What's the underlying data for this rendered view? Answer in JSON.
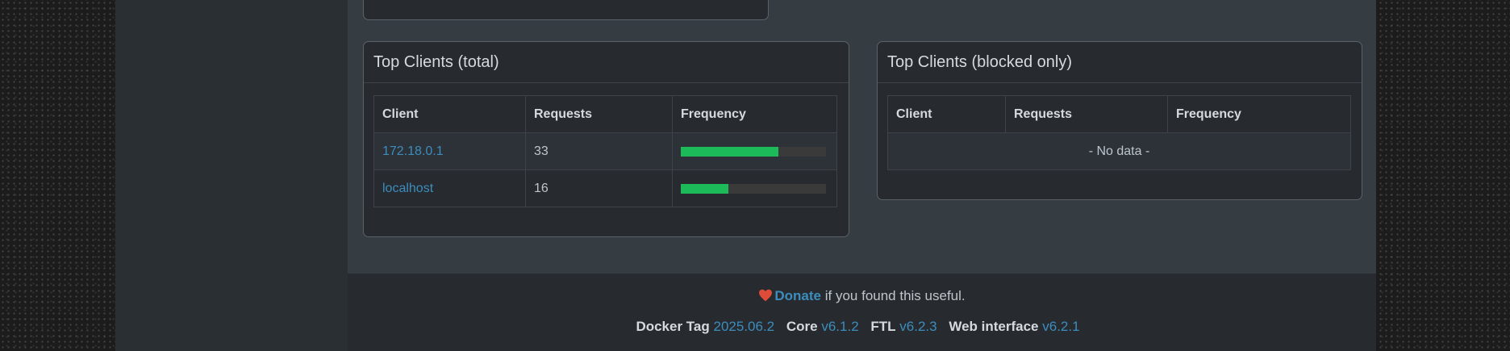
{
  "top_clients_total": {
    "title": "Top Clients (total)",
    "columns": [
      "Client",
      "Requests",
      "Frequency"
    ],
    "rows": [
      {
        "client": "172.18.0.1",
        "requests": "33",
        "frequency": 0.67
      },
      {
        "client": "localhost",
        "requests": "16",
        "frequency": 0.33
      }
    ]
  },
  "top_clients_blocked": {
    "title": "Top Clients (blocked only)",
    "columns": [
      "Client",
      "Requests",
      "Frequency"
    ],
    "empty_text": "- No data -"
  },
  "footer": {
    "donate_label": "Donate",
    "donate_suffix": "if you found this useful.",
    "versions": [
      {
        "label": "Docker Tag",
        "value": "2025.06.2"
      },
      {
        "label": "Core",
        "value": "v6.1.2"
      },
      {
        "label": "FTL",
        "value": "v6.2.3"
      },
      {
        "label": "Web interface",
        "value": "v6.2.1"
      }
    ]
  },
  "colors": {
    "accent": "#3c8dbc",
    "bar": "#1dba5a",
    "heart": "#dd4b39"
  }
}
